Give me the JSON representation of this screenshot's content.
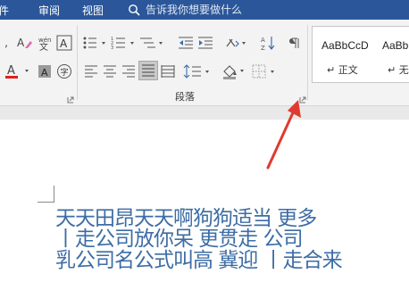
{
  "tabs": [
    {
      "label": "件"
    },
    {
      "label": "审阅"
    },
    {
      "label": "视图"
    }
  ],
  "tell_me": {
    "text": "告诉我你想要做什么",
    "icon": "lightbulb-icon"
  },
  "ribbon": {
    "paragraph_group_label": "段落",
    "font_icons": [
      "eraser-icon",
      "phonetic-guide-icon",
      "character-border-icon",
      "font-color-icon",
      "character-shading-icon",
      "enclose-characters-icon"
    ],
    "paragraph_icons": [
      "bullets-icon",
      "numbering-icon",
      "multilevel-list-icon",
      "decrease-indent-icon",
      "increase-indent-icon",
      "chinese-layout-icon",
      "sort-icon",
      "show-marks-icon",
      "align-left-icon",
      "center-icon",
      "align-right-icon",
      "justify-icon",
      "distributed-icon",
      "line-spacing-icon",
      "shading-icon",
      "borders-icon"
    ]
  },
  "styles": [
    {
      "sample": "AaBbCcD",
      "name": "正文"
    },
    {
      "sample": "AaBbCc",
      "name": "无"
    }
  ],
  "document": {
    "lines": [
      "天天田昂天天啊狗狗适当 更多",
      "丨走公司放你呆 更贯走 公司",
      "乳公司名公式叫高 冀迎 丨走合来"
    ]
  },
  "colors": {
    "tabbar": "#2b579a",
    "doc_text": "#3d6da5",
    "arrow": "#e03a2f",
    "font_color_bar": "#e0201b"
  }
}
